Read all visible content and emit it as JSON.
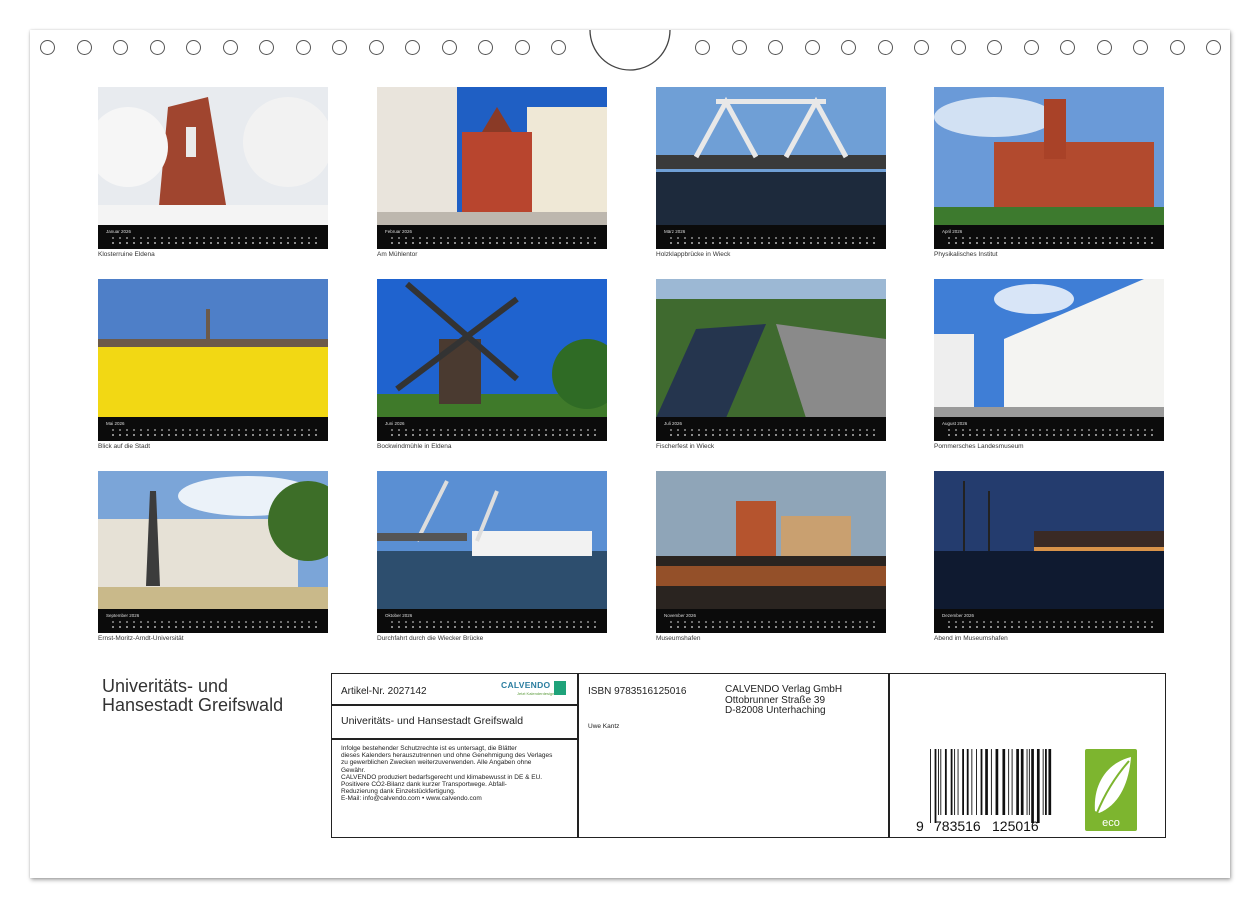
{
  "calendar": {
    "title_line1": "Univeritäts- und",
    "title_line2": "Hansestadt Greifswald",
    "months": [
      {
        "month": "Januar 2026",
        "caption": "Klosterruine Eldena",
        "scene": "snow",
        "colors": {
          "sky": "#dfe4ea",
          "ground": "#f4f4f4",
          "accent": "#a0452f"
        }
      },
      {
        "month": "Februar 2026",
        "caption": "Am Mühlentor",
        "scene": "street",
        "colors": {
          "sky": "#1f5fc4",
          "ground": "#bdb7ae",
          "accent": "#b8452e"
        }
      },
      {
        "month": "März 2026",
        "caption": "Holzklappbrücke in Wieck",
        "scene": "bridge",
        "colors": {
          "sky": "#6f9fd6",
          "ground": "#1d2a3c",
          "accent": "#e8e8e8"
        }
      },
      {
        "month": "April 2026",
        "caption": "Physikalisches Institut",
        "scene": "redbuilding",
        "colors": {
          "sky": "#6a9ad8",
          "ground": "#3d7a2e",
          "accent": "#b24a2e"
        }
      },
      {
        "month": "Mai 2026",
        "caption": "Blick auf die Stadt",
        "scene": "field",
        "colors": {
          "sky": "#4e7fc8",
          "ground": "#f2d814",
          "accent": "#6c5a4a"
        }
      },
      {
        "month": "Juni 2026",
        "caption": "Bockwindmühle in Eldena",
        "scene": "windmill",
        "colors": {
          "sky": "#1f63cf",
          "ground": "#3f7a2a",
          "accent": "#4a3a30"
        }
      },
      {
        "month": "Juli 2026",
        "caption": "Fischerfest in Wieck",
        "scene": "river",
        "colors": {
          "sky": "#9cb8d4",
          "ground": "#3f6a2f",
          "accent": "#25354e"
        }
      },
      {
        "month": "August 2026",
        "caption": "Pommersches Landesmuseum",
        "scene": "whitebuilding",
        "colors": {
          "sky": "#3f7ed6",
          "ground": "#9a9a9a",
          "accent": "#f4f4f2"
        }
      },
      {
        "month": "September 2026",
        "caption": "Ernst-Moritz-Arndt-Universität",
        "scene": "university",
        "colors": {
          "sky": "#7ba5d8",
          "ground": "#4f7a33",
          "accent": "#e6e1d6"
        }
      },
      {
        "month": "Oktober 2026",
        "caption": "Durchfahrt durch die Wiecker Brücke",
        "scene": "ferry",
        "colors": {
          "sky": "#5a8fd3",
          "ground": "#2d4e6e",
          "accent": "#f2f2f2"
        }
      },
      {
        "month": "November 2026",
        "caption": "Museumshafen",
        "scene": "harbor",
        "colors": {
          "sky": "#8fa5b8",
          "ground": "#2a2420",
          "accent": "#b5542e"
        }
      },
      {
        "month": "Dezember 2026",
        "caption": "Abend im Museumshafen",
        "scene": "evening",
        "colors": {
          "sky": "#243c6e",
          "ground": "#0f1a30",
          "accent": "#d8934a"
        }
      }
    ]
  },
  "infobox": {
    "article": "Artikel-Nr. 2027142",
    "logo_text": "CALVENDO",
    "logo_sub": "Jetzt Kalenderdesign",
    "product_title": "Univeritäts- und Hansestadt Greifswald",
    "legal_lines": [
      "Infolge bestehender Schutzrechte ist es untersagt, die Blätter",
      "dieses Kalenders herauszutrennen und ohne Genehmigung des Verlages",
      "zu gewerblichen Zwecken weiterzuverwenden. Alle Angaben ohne",
      "Gewähr.",
      "CALVENDO produziert bedarfsgerecht und klimabewusst in DE & EU.",
      "Positivere CO2-Bilanz dank kurzer Transportwege. Abfall-",
      "Reduzierung dank Einzelstückfertigung.",
      "E-Mail: info@calvendo.com • www.calvendo.com"
    ],
    "isbn": "ISBN 9783516125016",
    "author": "Uwe Kantz",
    "publisher_lines": [
      "CALVENDO Verlag GmbH",
      "Ottobrunner Straße 39",
      "D-82008 Unterhaching"
    ],
    "barcode_digits": {
      "first": "9",
      "left": "783516",
      "right": "125016"
    },
    "eco_label": "eco",
    "eco_color": "#7db52f"
  }
}
